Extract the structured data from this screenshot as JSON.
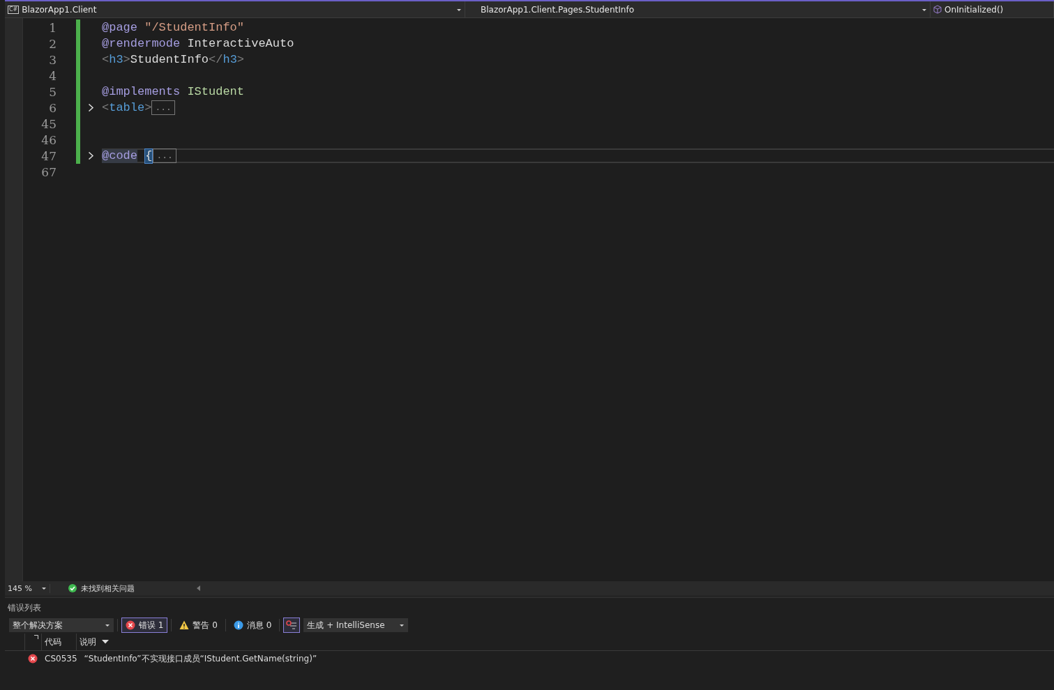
{
  "navigation_bar": {
    "project_icon": "C#",
    "project": "BlazorApp1.Client",
    "type": "BlazorApp1.Client.Pages.StudentInfo",
    "member": "OnInitialized()"
  },
  "editor": {
    "lines": [
      {
        "number": "1",
        "modified": true,
        "collapsible": false,
        "current": false,
        "tokens": [
          {
            "kind": "directive",
            "text": "@page"
          },
          {
            "kind": "string",
            "text": "\"/StudentInfo\""
          }
        ]
      },
      {
        "number": "2",
        "modified": true,
        "collapsible": false,
        "current": false,
        "tokens": [
          {
            "kind": "directive",
            "text": "@rendermode"
          },
          {
            "kind": "text",
            "text": "InteractiveAuto"
          }
        ]
      },
      {
        "number": "3",
        "modified": true,
        "collapsible": false,
        "current": false,
        "tokens": [
          {
            "kind": "bracket",
            "text": "<"
          },
          {
            "kind": "tag",
            "text": "h3"
          },
          {
            "kind": "bracket",
            "text": ">"
          },
          {
            "kind": "text",
            "text": "StudentInfo"
          },
          {
            "kind": "bracket",
            "text": "</"
          },
          {
            "kind": "tag",
            "text": "h3"
          },
          {
            "kind": "bracket",
            "text": ">"
          }
        ]
      },
      {
        "number": "4",
        "modified": true,
        "collapsible": false,
        "current": false
      },
      {
        "number": "5",
        "modified": true,
        "collapsible": false,
        "current": false,
        "tokens": [
          {
            "kind": "directive",
            "text": "@implements"
          },
          {
            "kind": "type",
            "text": "IStudent"
          }
        ]
      },
      {
        "number": "6",
        "modified": true,
        "collapsible": true,
        "current": false,
        "tokens": [
          {
            "kind": "bracket",
            "text": "<"
          },
          {
            "kind": "tag",
            "text": "table"
          },
          {
            "kind": "bracket",
            "text": ">"
          },
          {
            "kind": "collapsed",
            "text": "..."
          }
        ]
      },
      {
        "number": "45",
        "modified": true,
        "collapsible": false,
        "current": false
      },
      {
        "number": "46",
        "modified": true,
        "collapsible": false,
        "current": false
      },
      {
        "number": "47",
        "modified": true,
        "collapsible": true,
        "current": true,
        "tokens": [
          {
            "kind": "directive",
            "text": "@code"
          },
          {
            "kind": "brace",
            "text": "{"
          },
          {
            "kind": "collapsed",
            "text": "..."
          }
        ]
      },
      {
        "number": "67",
        "modified": false,
        "collapsible": false,
        "current": false
      }
    ]
  },
  "status_bar": {
    "zoom": "145 %",
    "issues": "未找到相关问题"
  },
  "error_list": {
    "title": "错误列表",
    "scope": "整个解决方案",
    "filters": [
      {
        "kind": "error",
        "label": "错误 1",
        "selected": true
      },
      {
        "kind": "warning",
        "label": "警告 0",
        "selected": false
      },
      {
        "kind": "message",
        "label": "消息 0",
        "selected": false
      }
    ],
    "source": "生成 + IntelliSense",
    "columns": [
      "代码",
      "说明"
    ],
    "rows": [
      {
        "kind": "error",
        "code": "CS0535",
        "description": "“StudentInfo”不实现接口成员“IStudent.GetName(string)”"
      }
    ]
  }
}
